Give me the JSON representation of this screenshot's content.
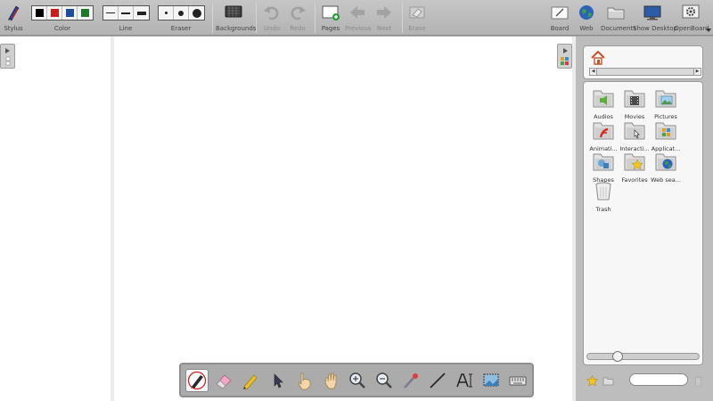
{
  "toolbar": {
    "stylus": "Stylus",
    "color": "Color",
    "line": "Line",
    "eraser": "Eraser",
    "backgrounds": "Backgrounds",
    "undo": "Undo",
    "redo": "Redo",
    "pages": "Pages",
    "previous": "Previous",
    "next": "Next",
    "erase": "Erase",
    "board": "Board",
    "web": "Web",
    "documents": "Documents",
    "show_desktop": "Show Desktop",
    "openboard": "OpenBoard"
  },
  "colors": [
    "#000000",
    "#d11a1a",
    "#1f4e9a",
    "#1e7a2a"
  ],
  "library": {
    "folders": [
      {
        "name": "Audios",
        "icon": "audios-folder-icon"
      },
      {
        "name": "Movies",
        "icon": "movies-folder-icon"
      },
      {
        "name": "Pictures",
        "icon": "pictures-folder-icon"
      },
      {
        "name": "Animati...",
        "icon": "animations-folder-icon"
      },
      {
        "name": "Interacti...",
        "icon": "interactivities-folder-icon"
      },
      {
        "name": "Applicat...",
        "icon": "applications-folder-icon"
      },
      {
        "name": "Shapes",
        "icon": "shapes-folder-icon"
      },
      {
        "name": "Favorites",
        "icon": "favorites-folder-icon"
      },
      {
        "name": "Web sea...",
        "icon": "web-search-folder-icon"
      },
      {
        "name": "Trash",
        "icon": "trash-folder-icon"
      }
    ],
    "search_value": ""
  },
  "palette": [
    "pen",
    "eraser",
    "marker",
    "selector",
    "interact",
    "hand",
    "zoom-in",
    "zoom-out",
    "laser-pointer",
    "line",
    "text",
    "capture",
    "keyboard"
  ]
}
